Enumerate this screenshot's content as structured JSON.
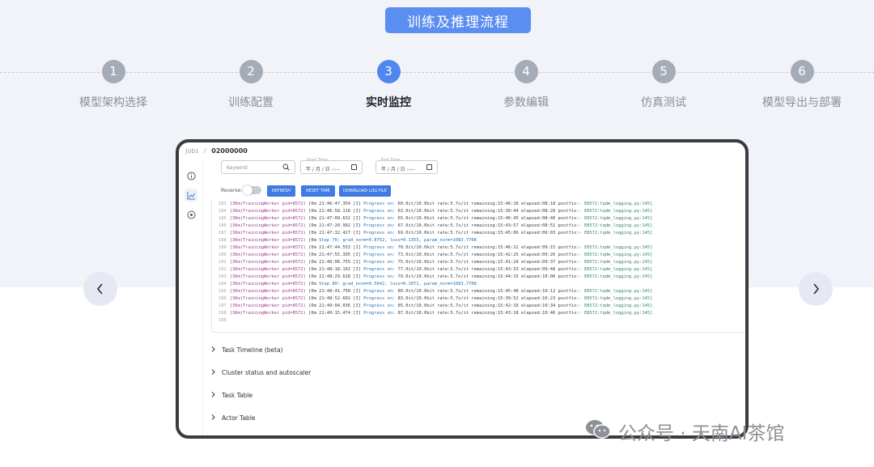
{
  "header": {
    "title": "训练及推理流程"
  },
  "steps": [
    {
      "num": "1",
      "label": "模型架构选择",
      "active": false
    },
    {
      "num": "2",
      "label": "训练配置",
      "active": false
    },
    {
      "num": "3",
      "label": "实时监控",
      "active": true
    },
    {
      "num": "4",
      "label": "参数编辑",
      "active": false
    },
    {
      "num": "5",
      "label": "仿真测试",
      "active": false
    },
    {
      "num": "6",
      "label": "模型导出与部署",
      "active": false
    }
  ],
  "screen": {
    "breadcrumb": {
      "root": "Jobs",
      "sep": "/",
      "current": "02000000"
    },
    "filters": {
      "keyword_placeholder": "Keyword",
      "start_label": "Start Time",
      "end_label": "End Time",
      "date_placeholder": "年 / 月 / 日 --:--"
    },
    "controls": {
      "reverse_label": "Reverse:",
      "refresh": "REFRESH",
      "reset_time": "RESET TIME",
      "download": "DOWNLOAD LOG FILE"
    },
    "logs": [
      {
        "n": "183",
        "tag": "[36m(TrainingWorker pid=8572)",
        "time": "[0m 21:46:47.354 [I]",
        "kind": "progress",
        "body": "60.0it/10.0kit rate:5.7s/it remaining:15:46:16 elapsed:08:18 postfix:-",
        "src": "E8572:tqdm_logging.py:145]"
      },
      {
        "n": "184",
        "tag": "[36m(TrainingWorker pid=8572)",
        "time": "[0m 21:46:58.116 [I]",
        "kind": "progress",
        "body": "63.0it/10.0kit rate:5.7s/it remaining:15:39:44 elapsed:08:28 postfix:-",
        "src": "E8572:tqdm_logging.py:145]"
      },
      {
        "n": "185",
        "tag": "[36m(TrainingWorker pid=8572)",
        "time": "[0m 21:47:09.632 [I]",
        "kind": "progress",
        "body": "65.0it/10.0kit rate:5.7s/it remaining:15:46:45 elapsed:08:40 postfix:-",
        "src": "E8572:tqdm_logging.py:145]"
      },
      {
        "n": "186",
        "tag": "[36m(TrainingWorker pid=8572)",
        "time": "[0m 21:47:20.992 [I]",
        "kind": "progress",
        "body": "67.0it/10.0kit rate:5.7s/it remaining:15:43:57 elapsed:08:51 postfix:-",
        "src": "E8572:tqdm_logging.py:145]"
      },
      {
        "n": "187",
        "tag": "[36m(TrainingWorker pid=8572)",
        "time": "[0m 21:47:32.427 [I]",
        "kind": "progress",
        "body": "69.0it/10.0kit rate:5.7s/it remaining:15:45:06 elapsed:09:03 postfix:-",
        "src": "E8572:tqdm_logging.py:145]"
      },
      {
        "n": "188",
        "tag": "[36m(TrainingWorker pid=8572)",
        "time": "[0m",
        "kind": "step",
        "body": "Step 70: grad_norm=0.8752, loss=0.1353, param_norm=1083.7708",
        "src": ""
      },
      {
        "n": "189",
        "tag": "[36m(TrainingWorker pid=8572)",
        "time": "[0m 21:47:44.553 [I]",
        "kind": "progress",
        "body": "70.0it/10.0kit rate:5.7s/it remaining:15:46:12 elapsed:09:15 postfix:-",
        "src": "E8572:tqdm_logging.py:145]"
      },
      {
        "n": "190",
        "tag": "[36m(TrainingWorker pid=8572)",
        "time": "[0m 21:47:55.395 [I]",
        "kind": "progress",
        "body": "73.0it/10.0kit rate:5.7s/it remaining:15:42:25 elapsed:09:26 postfix:-",
        "src": "E8572:tqdm_logging.py:145]"
      },
      {
        "n": "191",
        "tag": "[36m(TrainingWorker pid=8572)",
        "time": "[0m 21:48:06.755 [I]",
        "kind": "progress",
        "body": "75.0it/10.0kit rate:5.7s/it remaining:15:41:24 elapsed:09:37 postfix:-",
        "src": "E8572:tqdm_logging.py:145]"
      },
      {
        "n": "192",
        "tag": "[36m(TrainingWorker pid=8572)",
        "time": "[0m 21:48:18.192 [I]",
        "kind": "progress",
        "body": "77.0it/10.0kit rate:5.7s/it remaining:15:43:33 elapsed:09:48 postfix:-",
        "src": "E8572:tqdm_logging.py:145]"
      },
      {
        "n": "193",
        "tag": "[36m(TrainingWorker pid=8572)",
        "time": "[0m 21:48:29.628 [I]",
        "kind": "progress",
        "body": "79.0it/10.0kit rate:5.7s/it remaining:15:44:15 elapsed:10:00 postfix:-",
        "src": "E8572:tqdm_logging.py:145]"
      },
      {
        "n": "194",
        "tag": "[36m(TrainingWorker pid=8572)",
        "time": "[0m",
        "kind": "step",
        "body": "Step 80: grad_norm=0.5642, loss=0.1071, param_norm=1083.7708",
        "src": ""
      },
      {
        "n": "195",
        "tag": "[36m(TrainingWorker pid=8572)",
        "time": "[0m 21:48:41.758 [I]",
        "kind": "progress",
        "body": "80.0it/10.0kit rate:5.7s/it remaining:15:45:48 elapsed:10:12 postfix:-",
        "src": "E8572:tqdm_logging.py:145]"
      },
      {
        "n": "196",
        "tag": "[36m(TrainingWorker pid=8572)",
        "time": "[0m 21:48:52.602 [I]",
        "kind": "progress",
        "body": "83.0it/10.0kit rate:5.7s/it remaining:15:39:52 elapsed:10:23 postfix:-",
        "src": "E8572:tqdm_logging.py:145]"
      },
      {
        "n": "197",
        "tag": "[36m(TrainingWorker pid=8572)",
        "time": "[0m 21:49:04.036 [I]",
        "kind": "progress",
        "body": "85.0it/10.0kit rate:5.7s/it remaining:15:42:16 elapsed:10:34 postfix:-",
        "src": "E8572:tqdm_logging.py:145]"
      },
      {
        "n": "198",
        "tag": "[36m(TrainingWorker pid=8572)",
        "time": "[0m 21:49:15.474 [I]",
        "kind": "progress",
        "body": "87.0it/10.0kit rate:5.7s/it remaining:15:43:18 elapsed:10:46 postfix:-",
        "src": "E8572:tqdm_logging.py:145]"
      },
      {
        "n": "199",
        "tag": "",
        "time": "",
        "kind": "empty",
        "body": "",
        "src": ""
      }
    ],
    "progress_word": "Progress on:",
    "sections": [
      "Task Timeline (beta)",
      "Cluster status and autoscaler",
      "Task Table",
      "Actor Table"
    ]
  },
  "watermark": {
    "text": "公众号 · 天南AI茶馆",
    "icon": "wechat-icon"
  },
  "colors": {
    "accent": "#5a8ef0",
    "active_step": "#4f87ee",
    "inactive_step": "#a5abb7",
    "button": "#3f7be0"
  }
}
